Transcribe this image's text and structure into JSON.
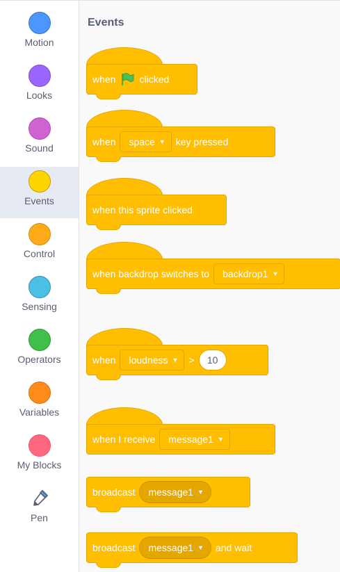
{
  "categories": [
    {
      "label": "Motion",
      "color": "#4c97ff"
    },
    {
      "label": "Looks",
      "color": "#9966ff"
    },
    {
      "label": "Sound",
      "color": "#cf63cf"
    },
    {
      "label": "Events",
      "color": "#ffd500",
      "selected": true
    },
    {
      "label": "Control",
      "color": "#ffab19"
    },
    {
      "label": "Sensing",
      "color": "#4cbfe6"
    },
    {
      "label": "Operators",
      "color": "#40bf4a"
    },
    {
      "label": "Variables",
      "color": "#ff8c1a"
    },
    {
      "label": "My Blocks",
      "color": "#ff6680"
    },
    {
      "label": "Pen",
      "icon": "pen-icon"
    }
  ],
  "palette": {
    "section_title": "Events",
    "block_color": "#ffbf00",
    "blocks": {
      "flag_clicked": {
        "when": "when",
        "clicked": "clicked",
        "icon": "green-flag-icon"
      },
      "key_pressed": {
        "when": "when",
        "key_value": "space",
        "key_pressed": "key pressed"
      },
      "sprite_clicked": {
        "text": "when this sprite clicked"
      },
      "backdrop_switches": {
        "text": "when backdrop switches to",
        "backdrop_value": "backdrop1"
      },
      "greater_than": {
        "when": "when",
        "sensor_value": "loudness",
        "operator": ">",
        "number": "10"
      },
      "receive": {
        "text": "when I receive",
        "message_value": "message1"
      },
      "broadcast": {
        "text": "broadcast",
        "message_value": "message1"
      },
      "broadcast_wait": {
        "text": "broadcast",
        "message_value": "message1",
        "and_wait": "and wait"
      }
    }
  }
}
